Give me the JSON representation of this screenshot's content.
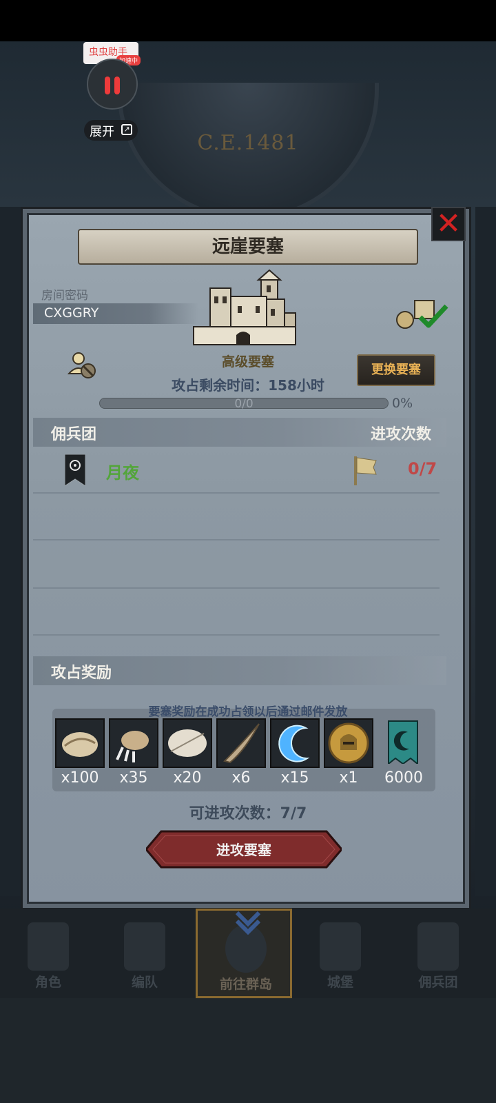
{
  "background": {
    "year": "C.E.1481"
  },
  "assistant": {
    "tag": "虫虫助手",
    "badge": "加速中",
    "expand_label": "展开"
  },
  "modal": {
    "title": "远崖要塞",
    "close_icon": "close-icon",
    "room_label": "房间密码",
    "room_code": "CXGGRY",
    "fort_type": "高级要塞",
    "time_remaining": "攻占剩余时间：158小时",
    "progress_text": "0/0",
    "progress_percent": "0%",
    "progress_value": 0,
    "swap_button": "更换要塞",
    "mercenary_header": "佣兵团",
    "attack_count_header": "进攻次数",
    "clan_name": "月夜",
    "clan_attacks": "0/7",
    "reward_header": "攻占奖励",
    "reward_note": "要塞奖励在成功占领以后通过邮件发放",
    "rewards": [
      {
        "icon": "fur-pelt-icon",
        "qty": "x100"
      },
      {
        "icon": "claw-icon",
        "qty": "x35"
      },
      {
        "icon": "feather-icon",
        "qty": "x20"
      },
      {
        "icon": "horn-icon",
        "qty": "x6"
      },
      {
        "icon": "blue-crescent-icon",
        "qty": "x15"
      },
      {
        "icon": "helmet-medal-icon",
        "qty": "x1"
      },
      {
        "icon": "moon-banner-icon",
        "qty": "6000"
      }
    ],
    "attacks_left": "可进攻次数：7/7",
    "attack_button": "进攻要塞"
  },
  "nav": {
    "items": [
      "角色",
      "编队",
      "前往群岛",
      "城堡",
      "佣兵团"
    ],
    "active_index": 2
  },
  "colors": {
    "clan_green": "#53a53a",
    "count_red": "#c04848",
    "swap_gold": "#e8b155",
    "attack_button": "#8a2f2f"
  }
}
